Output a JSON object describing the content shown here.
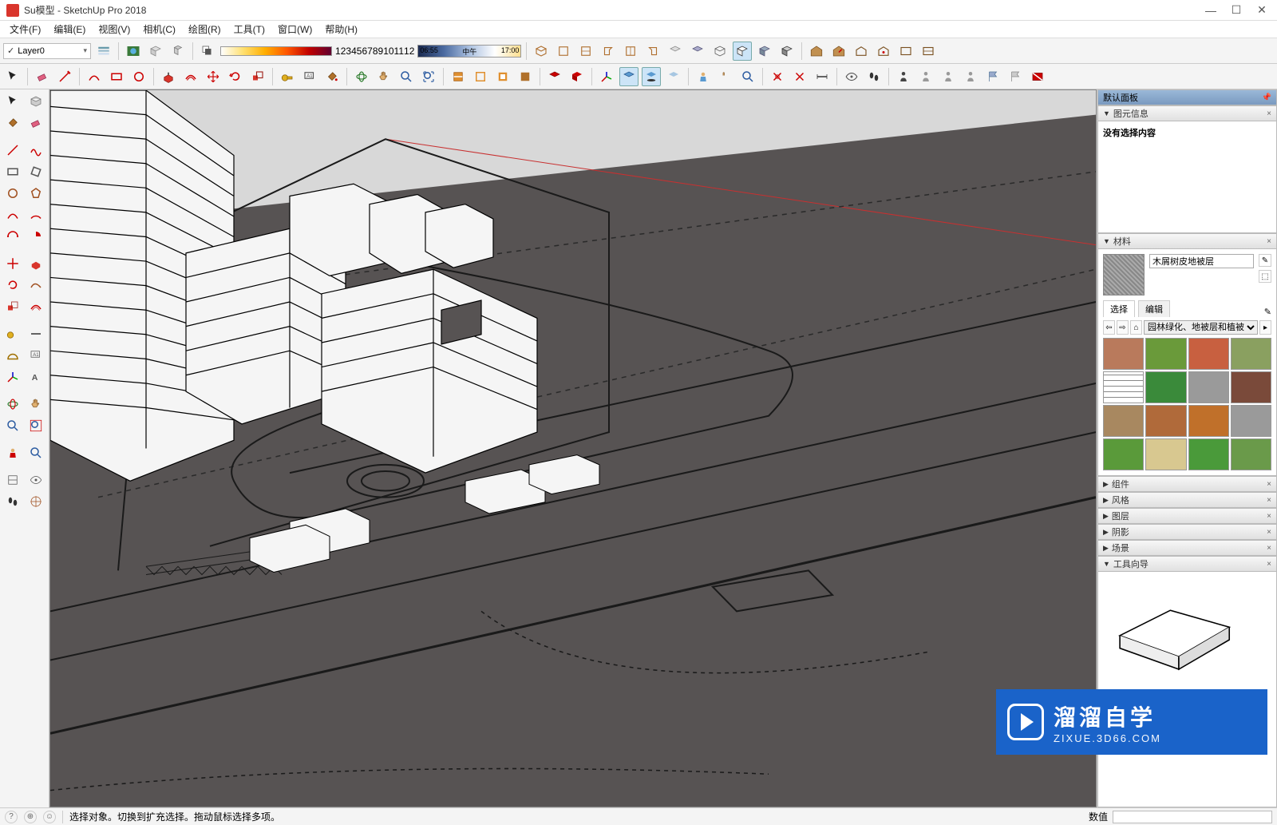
{
  "title": "Su模型 - SketchUp Pro 2018",
  "menubar": [
    "文件(F)",
    "编辑(E)",
    "视图(V)",
    "相机(C)",
    "绘图(R)",
    "工具(T)",
    "窗口(W)",
    "帮助(H)"
  ],
  "layer": {
    "current": "Layer0"
  },
  "shadow_scale": [
    "1",
    "2",
    "3",
    "4",
    "5",
    "6",
    "7",
    "8",
    "9",
    "10",
    "11",
    "12"
  ],
  "time_slider": {
    "start": "06:55",
    "mid": "中午",
    "end": "17:00"
  },
  "right_panel_title": "默认面板",
  "panels": {
    "entity": {
      "title": "图元信息",
      "message": "没有选择内容"
    },
    "materials": {
      "title": "材料",
      "current_name": "木屑树皮地被层",
      "tabs": {
        "select": "选择",
        "edit": "编辑"
      },
      "library": "园林绿化、地被层和植被",
      "swatches": [
        "#b97a5c",
        "#6a9a3a",
        "#c86040",
        "#8aa060",
        "#eeeeee",
        "#3a8a3a",
        "#9a9a9a",
        "#7a4a3a",
        "#a88860",
        "#b06a3a",
        "#c0702a",
        "#9a9a9a",
        "#5a9a3a",
        "#d8c890",
        "#4a9a3a",
        "#6a9a4a"
      ]
    },
    "collapsed": [
      "组件",
      "风格",
      "图层",
      "阴影",
      "场景",
      "工具向导"
    ]
  },
  "statusbar": {
    "hint": "选择对象。切换到扩充选择。拖动鼠标选择多项。",
    "value_label": "数值"
  },
  "watermark": {
    "cn": "溜溜自学",
    "en": "ZIXUE.3D66.COM"
  }
}
